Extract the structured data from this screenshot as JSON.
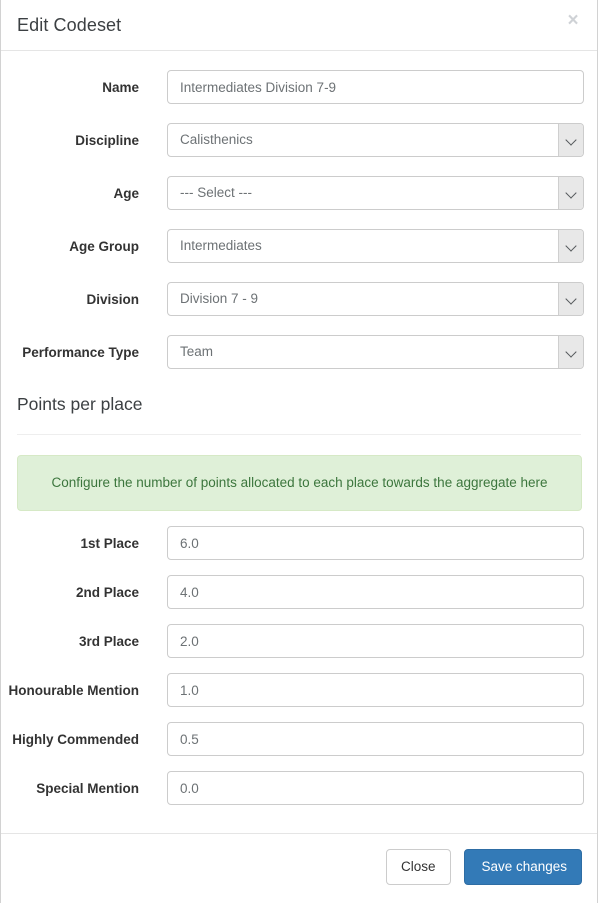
{
  "modal": {
    "title": "Edit Codeset",
    "close_icon_label": "×"
  },
  "form": {
    "fields": [
      {
        "label": "Name",
        "type": "text",
        "value": "Intermediates Division 7-9"
      },
      {
        "label": "Discipline",
        "type": "select",
        "value": "Calisthenics"
      },
      {
        "label": "Age",
        "type": "select",
        "value": "--- Select ---"
      },
      {
        "label": "Age Group",
        "type": "select",
        "value": "Intermediates"
      },
      {
        "label": "Division",
        "type": "select",
        "value": "Division 7 - 9"
      },
      {
        "label": "Performance Type",
        "type": "select",
        "value": "Team"
      }
    ]
  },
  "points_section": {
    "heading": "Points per place",
    "alert": "Configure the number of points allocated to each place towards the aggregate here",
    "alert_bg": "#dff0d8",
    "alert_text_color": "#3c763d",
    "fields": [
      {
        "label": "1st Place",
        "value": "6.0"
      },
      {
        "label": "2nd Place",
        "value": "4.0"
      },
      {
        "label": "3rd Place",
        "value": "2.0"
      },
      {
        "label": "Honourable Mention",
        "value": "1.0"
      },
      {
        "label": "Highly Commended",
        "value": "0.5"
      },
      {
        "label": "Special Mention",
        "value": "0.0"
      }
    ]
  },
  "footer": {
    "close_label": "Close",
    "save_label": "Save changes",
    "primary_color": "#337ab7"
  }
}
